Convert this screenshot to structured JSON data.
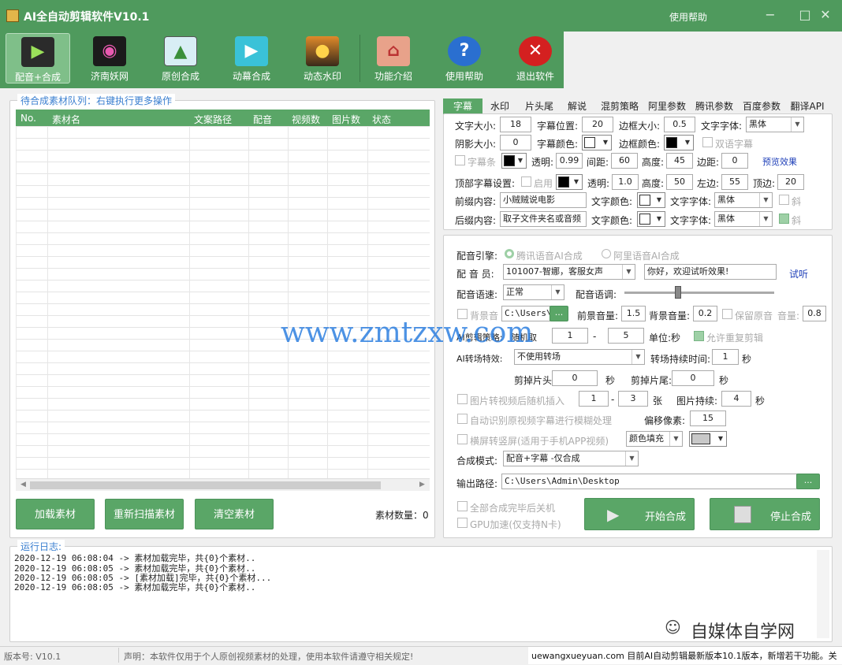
{
  "window": {
    "title": "AI全自动剪辑软件V10.1",
    "help": "使用帮助",
    "min": "−",
    "max": "□",
    "close": "✕"
  },
  "toolbar": [
    {
      "label": "配音+合成",
      "icon": "clapper-icon"
    },
    {
      "label": "济南妖网",
      "icon": "film-reel-icon"
    },
    {
      "label": "原创合成",
      "icon": "picture-icon"
    },
    {
      "label": "动幕合成",
      "icon": "video-play-icon"
    },
    {
      "label": "动态水印",
      "icon": "sunset-icon"
    },
    {
      "label": "功能介绍",
      "icon": "home-icon"
    },
    {
      "label": "使用帮助",
      "icon": "question-icon"
    },
    {
      "label": "退出软件",
      "icon": "exit-icon"
    }
  ],
  "queue": {
    "legend": "待合成素材队列：右键执行更多操作",
    "columns": [
      "No.",
      "素材名",
      "文案路径",
      "配音",
      "视频数",
      "图片数",
      "状态"
    ],
    "load": "加载素材",
    "rescan": "重新扫描素材",
    "clear": "清空素材",
    "count_label": "素材数量：0"
  },
  "tabs": [
    "字幕",
    "水印",
    "片头尾",
    "解说",
    "混剪策略",
    "阿里参数",
    "腾讯参数",
    "百度参数",
    "翻译API"
  ],
  "subtitle": {
    "font_size_label": "文字大小:",
    "font_size": "18",
    "pos_label": "字幕位置:",
    "pos": "20",
    "border_label": "边框大小:",
    "border": "0.5",
    "font_label": "文字字体:",
    "font": "黑体",
    "shadow_label": "阴影大小:",
    "shadow": "0",
    "color_label": "字幕颜色:",
    "border_color_label": "边框颜色:",
    "dual_label": "双语字幕",
    "bar_label": "字幕条",
    "alpha_label": "透明:",
    "alpha": "0.99",
    "spacing_label": "间距:",
    "spacing": "60",
    "height_label": "高度:",
    "height": "45",
    "margin_label": "边距:",
    "margin": "0",
    "preview": "预览效果",
    "top_label": "顶部字幕设置:",
    "enable_label": "启用",
    "top_alpha_label": "透明:",
    "top_alpha": "1.0",
    "top_height_label": "高度:",
    "top_height": "50",
    "left_label": "左边:",
    "left": "55",
    "topm_label": "顶边:",
    "topm": "20",
    "prefix_label": "前缀内容:",
    "prefix": "小贼贼说电影",
    "prefix_color_label": "文字颜色:",
    "prefix_font_label": "文字字体:",
    "prefix_font": "黑体",
    "italic_label": "斜",
    "suffix_label": "后缀内容:",
    "suffix": "取子文件夹名或音频",
    "suffix_color_label": "文字颜色:",
    "suffix_font_label": "文字字体:",
    "suffix_font": "黑体",
    "italic2_label": "斜"
  },
  "voice": {
    "engine_label": "配音引擎:",
    "engine1": "腾讯语音AI合成",
    "engine2": "阿里语音AI合成",
    "speaker_label": "配 音 员:",
    "speaker": "101007-智娜，客服女声",
    "test_text": "你好，欢迎试听效果!",
    "test": "试听",
    "speed_label": "配音语速:",
    "speed": "正常",
    "pitch_label": "配音语调:",
    "bgm_label": "背景音",
    "bgm_path": "C:\\Users\\A",
    "browse": "...",
    "fg_vol_label": "前景音量:",
    "fg_vol": "1.5",
    "bg_vol_label": "背景音量:",
    "bg_vol": "0.2",
    "keep_label": "保留原音",
    "vol_label": "音量:",
    "vol": "0.8",
    "strategy_label": "AI剪辑策略:",
    "random_label": "随机取",
    "r1": "1",
    "dash": "-",
    "r2": "5",
    "unit_label": "单位:秒",
    "repeat_label": "允许重复剪辑",
    "trans_label": "AI转场特效:",
    "trans": "不使用转场",
    "trans_dur_label": "转场持续时间:",
    "trans_dur": "1",
    "sec": "秒",
    "cut_head_label": "剪掉片头:",
    "cut_head": "0",
    "cut_tail_label": "剪掉片尾:",
    "cut_tail": "0",
    "img_label": "图片转视频后随机插入",
    "img1": "1",
    "img2": "3",
    "zhang": "张",
    "img_dur_label": "图片持续:",
    "img_dur": "4",
    "blur_label": "自动识别原视频字幕进行模糊处理",
    "offset_label": "偏移像素:",
    "offset": "15",
    "vertical_label": "横屏转竖屏(适用于手机APP视频)",
    "fill": "颜色填充",
    "mode_label": "合成模式:",
    "mode": "配音+字幕 -仅合成",
    "out_label": "输出路径:",
    "out": "C:\\Users\\Admin\\Desktop",
    "shutdown_label": "全部合成完毕后关机",
    "gpu_label": "GPU加速(仅支持N卡)",
    "start": "开始合成",
    "stop": "停止合成"
  },
  "log": {
    "legend": "运行日志:",
    "lines": [
      "2020-12-19 06:08:04 -> 素材加载完毕，共{0}个素材..",
      "2020-12-19 06:08:05 -> 素材加载完毕，共{0}个素材..",
      "2020-12-19 06:08:05 -> [素材加载]完毕，共{0}个素材...",
      "2020-12-19 06:08:05 -> 素材加载完毕，共{0}个素材.."
    ]
  },
  "watermark": {
    "site": "www.zmtzxw.com",
    "brand": "自媒体自学网"
  },
  "status": {
    "version": "版本号: V10.1",
    "notice": "声明：本软件仅用于个人原创视频素材的处理，使用本软件请遵守相关规定!",
    "ticker": "uewangxueyuan.com 目前AI自动剪辑最新版本10.1版本，新增若干功能。关"
  },
  "colors": {
    "accent": "#4f9a5d",
    "button": "#5aa667",
    "link": "#1e3fb8"
  }
}
